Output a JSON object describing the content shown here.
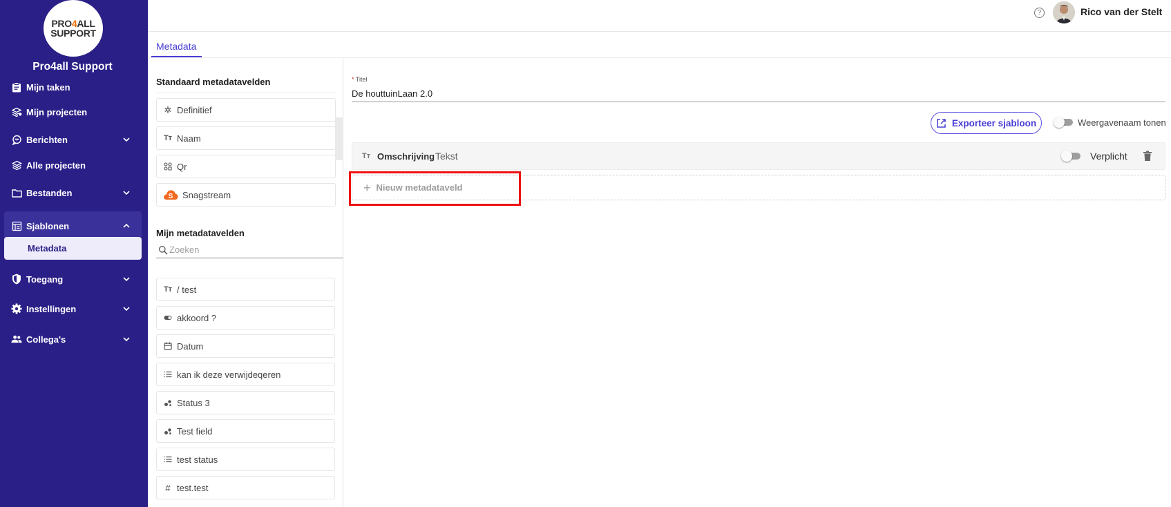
{
  "sidebar": {
    "logo": {
      "line1_a": "PRO",
      "line1_b": "4",
      "line1_c": "ALL",
      "line2": "SUPPORT"
    },
    "org_name": "Pro4all Support",
    "items": [
      {
        "label": "Mijn taken",
        "icon": "clipboard-icon"
      },
      {
        "label": "Mijn projecten",
        "icon": "layers-user-icon"
      },
      {
        "label": "Berichten",
        "icon": "chat-icon"
      },
      {
        "label": "Alle projecten",
        "icon": "layers-icon"
      },
      {
        "label": "Bestanden",
        "icon": "folder-icon"
      },
      {
        "label": "Sjablonen",
        "icon": "template-icon"
      },
      {
        "label": "Toegang",
        "icon": "shield-icon"
      },
      {
        "label": "Instellingen",
        "icon": "gear-icon"
      },
      {
        "label": "Collega's",
        "icon": "people-icon"
      }
    ],
    "sub_item": "Metadata",
    "colors": {
      "background": "#2a1f87",
      "active": "#3b319a",
      "sub_active_bg": "#eeecfb"
    }
  },
  "topbar": {
    "user_name": "Rico van der Stelt",
    "help_icon": "question-circle-icon"
  },
  "tabs": [
    {
      "label": "Metadata",
      "active": true
    }
  ],
  "standard_fields": {
    "title": "Standaard metadatavelden",
    "items": [
      {
        "label": "Definitief",
        "icon": "asterisk-icon"
      },
      {
        "label": "Naam",
        "icon": "text-format-icon"
      },
      {
        "label": "Qr",
        "icon": "qr-icon"
      },
      {
        "label": "Snagstream",
        "icon": "snagstream-icon"
      }
    ]
  },
  "my_fields": {
    "title": "Mijn metadatavelden",
    "search_placeholder": "Zoeken",
    "items": [
      {
        "label": "/ test",
        "icon": "text-format-icon"
      },
      {
        "label": "akkoord ?",
        "icon": "toggle-icon"
      },
      {
        "label": "Datum",
        "icon": "calendar-icon"
      },
      {
        "label": "kan ik deze verwijdeqeren",
        "icon": "list-icon"
      },
      {
        "label": "Status 3",
        "icon": "status-icon"
      },
      {
        "label": "Test field",
        "icon": "status-icon"
      },
      {
        "label": "test status",
        "icon": "list-icon"
      },
      {
        "label": "test.test",
        "icon": "hash-icon"
      }
    ]
  },
  "editor": {
    "title_label": "Titel",
    "title_required_mark": "*",
    "title_value": "De houttuinLaan 2.0",
    "export_button": "Exporteer sjabloon",
    "display_name_toggle": "Weergavenaam tonen",
    "field_row": {
      "name": "Omschrijving",
      "type": "Tekst",
      "required_label": "Verplicht"
    },
    "new_field_label": "Nieuw metadataveld",
    "accent": "#4a3ed6",
    "highlight_color": "#e11111"
  }
}
